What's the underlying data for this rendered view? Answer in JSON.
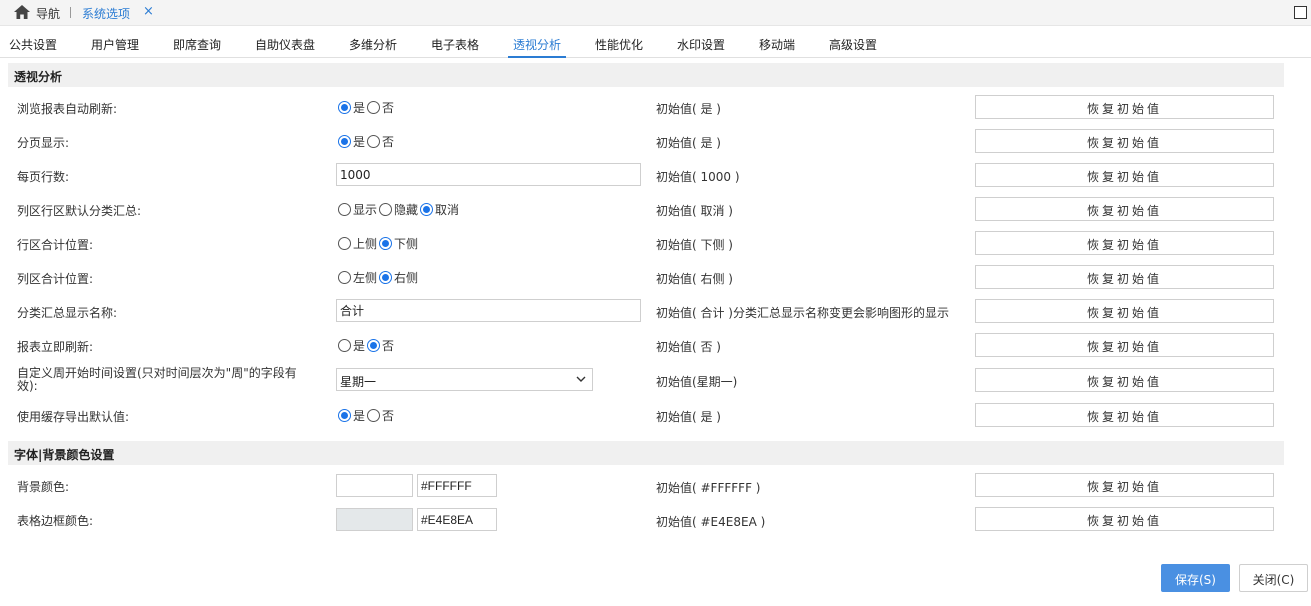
{
  "topbar": {
    "nav_label": "导航",
    "active_tab": "系统选项",
    "close_glyph": "×"
  },
  "subtabs": [
    {
      "label": "公共设置"
    },
    {
      "label": "用户管理"
    },
    {
      "label": "即席查询"
    },
    {
      "label": "自助仪表盘"
    },
    {
      "label": "多维分析"
    },
    {
      "label": "电子表格"
    },
    {
      "label": "透视分析",
      "active": true
    },
    {
      "label": "性能优化"
    },
    {
      "label": "水印设置"
    },
    {
      "label": "移动端"
    },
    {
      "label": "高级设置"
    }
  ],
  "sections": {
    "pivot": "透视分析",
    "font_bg": "字体|背景颜色设置"
  },
  "reset_label": "恢复初始值",
  "rows": {
    "auto_refresh": {
      "label": "浏览报表自动刷新:",
      "options": [
        "是",
        "否"
      ],
      "selected": "是",
      "initial": "初始值( 是 )"
    },
    "paging": {
      "label": "分页显示:",
      "options": [
        "是",
        "否"
      ],
      "selected": "是",
      "initial": "初始值( 是 )"
    },
    "rows_per_page": {
      "label": "每页行数:",
      "value": "1000",
      "initial": "初始值( 1000 )"
    },
    "col_subtotal": {
      "label": "列区行区默认分类汇总:",
      "options": [
        "显示",
        "隐藏",
        "取消"
      ],
      "selected": "取消",
      "initial": "初始值( 取消 )"
    },
    "row_total_pos": {
      "label": "行区合计位置:",
      "options": [
        "上侧",
        "下侧"
      ],
      "selected": "下侧",
      "initial": "初始值( 下侧 )"
    },
    "col_total_pos": {
      "label": "列区合计位置:",
      "options": [
        "左侧",
        "右侧"
      ],
      "selected": "右侧",
      "initial": "初始值( 右侧 )"
    },
    "subtotal_name": {
      "label": "分类汇总显示名称:",
      "value": "合计",
      "initial": "初始值( 合计 )分类汇总显示名称变更会影响图形的显示"
    },
    "immediate_refresh": {
      "label": "报表立即刷新:",
      "options": [
        "是",
        "否"
      ],
      "selected": "否",
      "initial": "初始值( 否 )"
    },
    "week_start": {
      "label": "自定义周开始时间设置(只对时间层次为\"周\"的字段有效):",
      "value": "星期一",
      "initial": "初始值(星期一)"
    },
    "cache_export": {
      "label": "使用缓存导出默认值:",
      "options": [
        "是",
        "否"
      ],
      "selected": "是",
      "initial": "初始值( 是 )"
    },
    "bg_color": {
      "label": "背景颜色:",
      "value": "#FFFFFF",
      "swatch": "#FFFFFF",
      "initial": "初始值( #FFFFFF )"
    },
    "border_color": {
      "label": "表格边框颜色:",
      "value": "#E4E8EA",
      "swatch": "#E4E8EA",
      "initial": "初始值( #E4E8EA )"
    }
  },
  "footer": {
    "save": "保存(S)",
    "close": "关闭(C)"
  },
  "colors": {
    "accent": "#2b7cd3",
    "primary_button": "#4a90e2",
    "section_bg": "#f0f0f0"
  }
}
